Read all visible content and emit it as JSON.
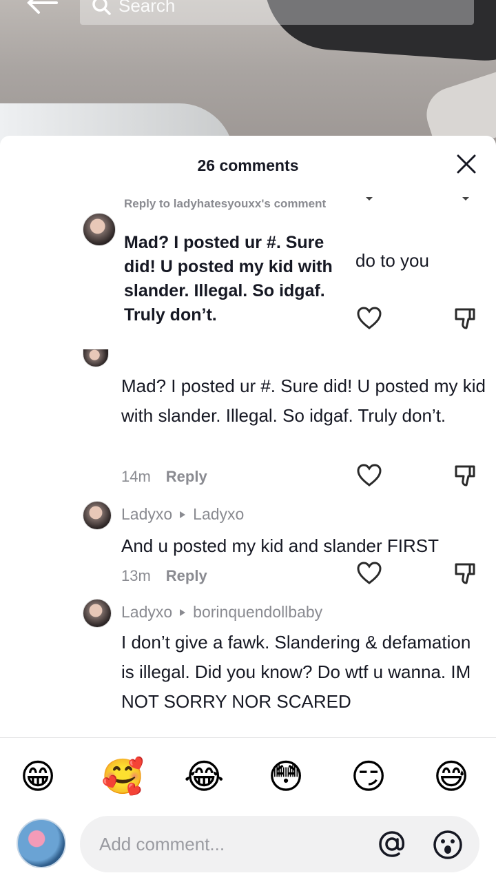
{
  "top_bar": {
    "search_placeholder": "Search"
  },
  "sheet": {
    "comments_count": "26 comments"
  },
  "reply_popup": {
    "reply_to": "Reply to ladyhatesyouxx's comment",
    "body": "Mad? I posted ur #. Sure did! U posted my kid with slander. Illegal. So idgaf. Truly don’t."
  },
  "underlay": {
    "partial_text": "do to you"
  },
  "comments": [
    {
      "text": "Mad? I posted ur #. Sure did! U posted my kid with slander. Illegal. So idgaf. Truly don’t.",
      "time": "14m",
      "reply_label": "Reply"
    },
    {
      "author": "Ladyxo",
      "reply_to": "Ladyxo",
      "text": "And u posted my kid and slander FIRST",
      "time": "13m",
      "reply_label": "Reply"
    },
    {
      "author": "Ladyxo",
      "reply_to": "borinquendollbaby",
      "text": "I don’t give a fawk. Slandering & defamation is illegal. Did you know? Do wtf u wanna. IM NOT SORRY NOR SCARED"
    }
  ],
  "emoji_bar": [
    "😁",
    "🥰",
    "😂",
    "😳",
    "😏",
    "😅"
  ],
  "input": {
    "placeholder": "Add comment..."
  },
  "colors": {
    "text": "#161823",
    "secondary": "#8a8b91",
    "input_bg": "#f1f1f2"
  }
}
